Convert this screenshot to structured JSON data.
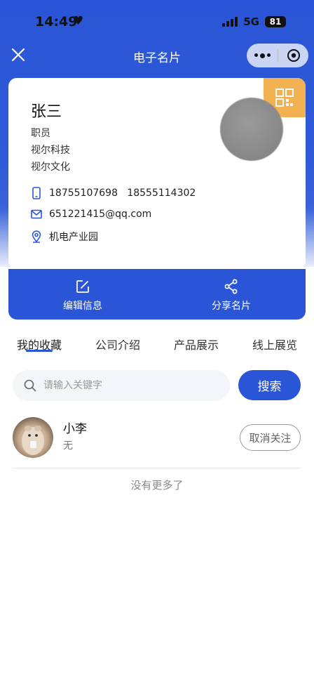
{
  "status_bar": {
    "time": "14:49",
    "network": "5G",
    "battery": "81"
  },
  "nav": {
    "title": "电子名片"
  },
  "card": {
    "name": "张三",
    "position": "职员",
    "company_1": "视尔科技",
    "company_2": "视尔文化",
    "phones": "18755107698   18555114302",
    "email": "651221415@qq.com",
    "address": "机电产业园"
  },
  "actions": {
    "edit_label": "编辑信息",
    "share_label": "分享名片"
  },
  "tabs": [
    "我的收藏",
    "公司介绍",
    "产品展示",
    "线上展览"
  ],
  "search": {
    "placeholder": "请输入关键字",
    "button_label": "搜索"
  },
  "favorites": [
    {
      "name": "小李",
      "subtitle": "无",
      "action_label": "取消关注"
    }
  ],
  "list_footer": "没有更多了",
  "colors": {
    "primary": "#2a55d6",
    "qr_badge": "#f3b251"
  }
}
